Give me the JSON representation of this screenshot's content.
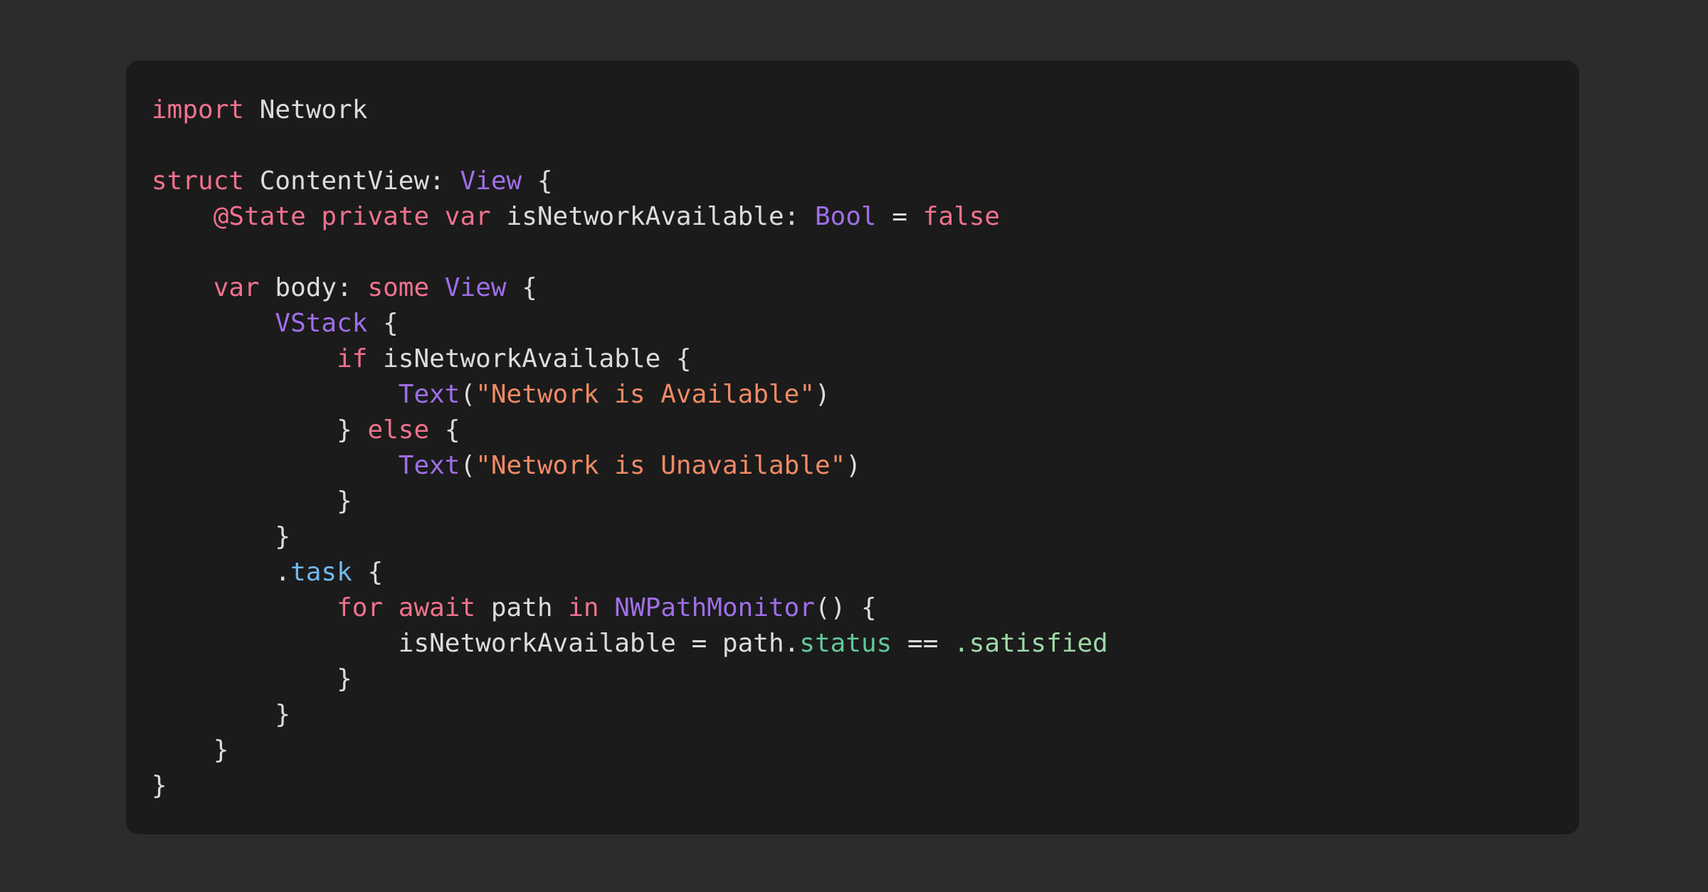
{
  "colors": {
    "background": "#2c2c2c",
    "card": "#1b1b1b",
    "plain": "#dcdcdc",
    "keyword": "#f0728d",
    "type": "#a06ee8",
    "string": "#f08a64",
    "property": "#62c89a",
    "member": "#9fd7a8",
    "method": "#72b9ee"
  },
  "code": {
    "lines": [
      [
        {
          "t": "kw",
          "v": "import"
        },
        {
          "t": "plain",
          "v": " Network"
        }
      ],
      [],
      [
        {
          "t": "kw",
          "v": "struct"
        },
        {
          "t": "plain",
          "v": " ContentView: "
        },
        {
          "t": "type",
          "v": "View"
        },
        {
          "t": "plain",
          "v": " {"
        }
      ],
      [
        {
          "t": "plain",
          "v": "    "
        },
        {
          "t": "kw",
          "v": "@State private var"
        },
        {
          "t": "plain",
          "v": " isNetworkAvailable: "
        },
        {
          "t": "type",
          "v": "Bool"
        },
        {
          "t": "plain",
          "v": " = "
        },
        {
          "t": "kw",
          "v": "false"
        }
      ],
      [],
      [
        {
          "t": "plain",
          "v": "    "
        },
        {
          "t": "kw",
          "v": "var"
        },
        {
          "t": "plain",
          "v": " body: "
        },
        {
          "t": "kw",
          "v": "some"
        },
        {
          "t": "plain",
          "v": " "
        },
        {
          "t": "type",
          "v": "View"
        },
        {
          "t": "plain",
          "v": " {"
        }
      ],
      [
        {
          "t": "plain",
          "v": "        "
        },
        {
          "t": "type",
          "v": "VStack"
        },
        {
          "t": "plain",
          "v": " {"
        }
      ],
      [
        {
          "t": "plain",
          "v": "            "
        },
        {
          "t": "kw",
          "v": "if"
        },
        {
          "t": "plain",
          "v": " isNetworkAvailable {"
        }
      ],
      [
        {
          "t": "plain",
          "v": "                "
        },
        {
          "t": "type",
          "v": "Text"
        },
        {
          "t": "plain",
          "v": "("
        },
        {
          "t": "str",
          "v": "\"Network is Available\""
        },
        {
          "t": "plain",
          "v": ")"
        }
      ],
      [
        {
          "t": "plain",
          "v": "            } "
        },
        {
          "t": "kw",
          "v": "else"
        },
        {
          "t": "plain",
          "v": " {"
        }
      ],
      [
        {
          "t": "plain",
          "v": "                "
        },
        {
          "t": "type",
          "v": "Text"
        },
        {
          "t": "plain",
          "v": "("
        },
        {
          "t": "str",
          "v": "\"Network is Unavailable\""
        },
        {
          "t": "plain",
          "v": ")"
        }
      ],
      [
        {
          "t": "plain",
          "v": "            }"
        }
      ],
      [
        {
          "t": "plain",
          "v": "        }"
        }
      ],
      [
        {
          "t": "plain",
          "v": "        ."
        },
        {
          "t": "method",
          "v": "task"
        },
        {
          "t": "plain",
          "v": " {"
        }
      ],
      [
        {
          "t": "plain",
          "v": "            "
        },
        {
          "t": "kw",
          "v": "for await"
        },
        {
          "t": "plain",
          "v": " path "
        },
        {
          "t": "kw",
          "v": "in"
        },
        {
          "t": "plain",
          "v": " "
        },
        {
          "t": "type",
          "v": "NWPathMonitor"
        },
        {
          "t": "plain",
          "v": "() {"
        }
      ],
      [
        {
          "t": "plain",
          "v": "                isNetworkAvailable = path."
        },
        {
          "t": "prop",
          "v": "status"
        },
        {
          "t": "plain",
          "v": " == "
        },
        {
          "t": "member",
          "v": ".satisfied"
        }
      ],
      [
        {
          "t": "plain",
          "v": "            }"
        }
      ],
      [
        {
          "t": "plain",
          "v": "        }"
        }
      ],
      [
        {
          "t": "plain",
          "v": "    }"
        }
      ],
      [
        {
          "t": "plain",
          "v": "}"
        }
      ]
    ]
  }
}
